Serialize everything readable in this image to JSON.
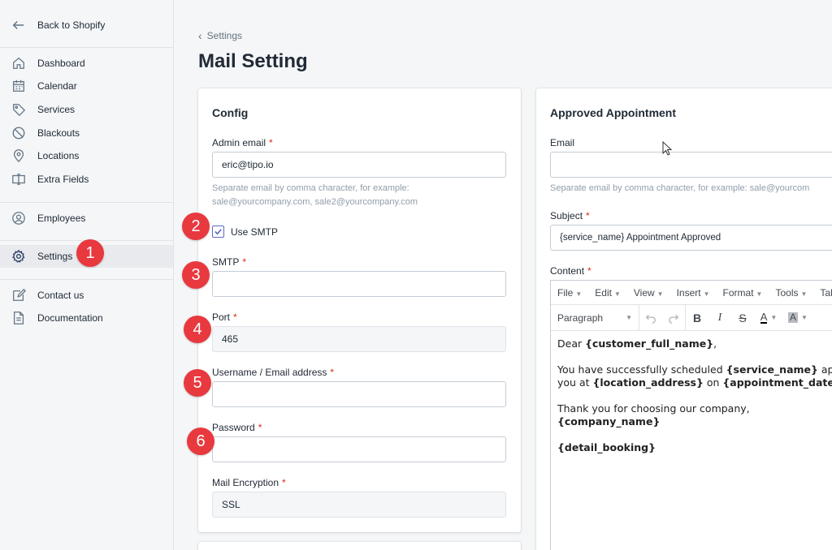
{
  "sidebar": {
    "back_label": "Back to Shopify",
    "items": [
      {
        "label": "Dashboard",
        "icon": "home-icon"
      },
      {
        "label": "Calendar",
        "icon": "calendar-icon"
      },
      {
        "label": "Services",
        "icon": "tag-icon"
      },
      {
        "label": "Blackouts",
        "icon": "blocked-icon"
      },
      {
        "label": "Locations",
        "icon": "location-pin-icon"
      },
      {
        "label": "Extra Fields",
        "icon": "text-field-icon"
      },
      {
        "label": "Employees",
        "icon": "user-icon"
      },
      {
        "label": "Settings",
        "icon": "gear-icon"
      },
      {
        "label": "Contact us",
        "icon": "compose-icon"
      },
      {
        "label": "Documentation",
        "icon": "document-icon"
      }
    ]
  },
  "breadcrumb": "Settings",
  "page_title": "Mail Setting",
  "config": {
    "title": "Config",
    "admin_email_label": "Admin email",
    "admin_email_value": "eric@tipo.io",
    "admin_email_help_1": "Separate email by comma character, for example:",
    "admin_email_help_2": "sale@yourcompany.com, sale2@yourcompany.com",
    "use_smtp_label": "Use SMTP",
    "use_smtp_checked": true,
    "smtp_label": "SMTP",
    "smtp_value": "",
    "port_label": "Port",
    "port_value": "465",
    "username_label": "Username / Email address",
    "username_value": "",
    "password_label": "Password",
    "password_value": "",
    "encryption_label": "Mail Encryption",
    "encryption_value": "SSL"
  },
  "approved": {
    "title": "Approved Appointment",
    "email_label": "Email",
    "email_value": "",
    "email_help": "Separate email by comma character, for example: sale@yourcom",
    "subject_label": "Subject",
    "subject_value": "{service_name} Appointment Approved",
    "content_label": "Content",
    "menu": [
      "File",
      "Edit",
      "View",
      "Insert",
      "Format",
      "Tools",
      "Tab"
    ],
    "paragraph_label": "Paragraph",
    "body": {
      "dear": "Dear ",
      "customer_full_name": "{customer_full_name}",
      "dear_end": ",",
      "line2_a": "You have successfully scheduled ",
      "service_name": "{service_name}",
      "line2_b": " ap",
      "line3_a": "you at ",
      "location_address": "{location_address}",
      "line3_b": " on ",
      "appointment_date": "{appointment_date",
      "thanks": "Thank you for choosing our company,",
      "company_name": "{company_name}",
      "detail_booking": "{detail_booking}"
    }
  },
  "badges": [
    "1",
    "2",
    "3",
    "4",
    "5",
    "6"
  ],
  "colors": {
    "badge": "#e8393f",
    "required": "#d72c0d",
    "checkbox": "#5c6ac4"
  }
}
